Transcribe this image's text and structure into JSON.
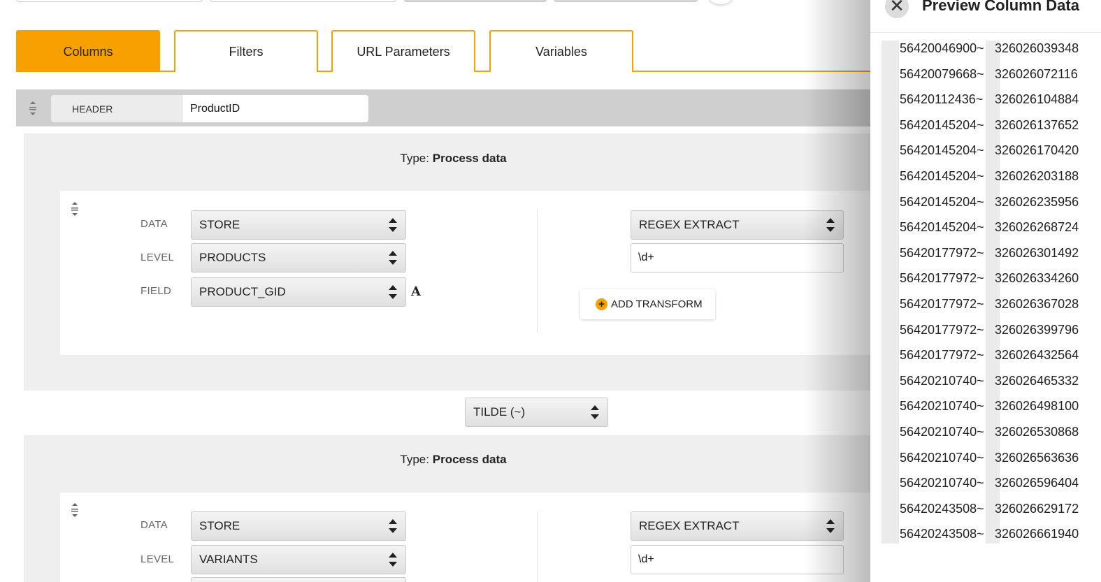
{
  "tabs": [
    {
      "label": "Columns",
      "active": true
    },
    {
      "label": "Filters",
      "active": false
    },
    {
      "label": "URL Parameters",
      "active": false
    },
    {
      "label": "Variables",
      "active": false
    }
  ],
  "header": {
    "label": "HEADER",
    "value": "ProductID"
  },
  "process_blocks": [
    {
      "type_prefix": "Type:",
      "type_value": "Process data",
      "fields": {
        "data_label": "DATA",
        "data_value": "STORE",
        "level_label": "LEVEL",
        "level_value": "PRODUCTS",
        "field_label": "FIELD",
        "field_value": "PRODUCT_GID",
        "field_type_icon": "A"
      },
      "transform": {
        "select_value": "REGEX EXTRACT",
        "pattern": "\\d+"
      },
      "add_transform_label": "ADD TRANSFORM"
    },
    {
      "type_prefix": "Type:",
      "type_value": "Process data",
      "fields": {
        "data_label": "DATA",
        "data_value": "STORE",
        "level_label": "LEVEL",
        "level_value": "VARIANTS"
      },
      "transform": {
        "select_value": "REGEX EXTRACT",
        "pattern": "\\d+"
      }
    }
  ],
  "separator": {
    "value": "TILDE (~)"
  },
  "preview": {
    "title": "Preview Column Data",
    "close_icon": "close-icon",
    "rows": [
      [
        "56420046900~",
        "326026039348"
      ],
      [
        "56420079668~",
        "326026072116"
      ],
      [
        "56420112436~",
        "326026104884"
      ],
      [
        "56420145204~",
        "326026137652"
      ],
      [
        "56420145204~",
        "326026170420"
      ],
      [
        "56420145204~",
        "326026203188"
      ],
      [
        "56420145204~",
        "326026235956"
      ],
      [
        "56420145204~",
        "326026268724"
      ],
      [
        "56420177972~",
        "326026301492"
      ],
      [
        "56420177972~",
        "326026334260"
      ],
      [
        "56420177972~",
        "326026367028"
      ],
      [
        "56420177972~",
        "326026399796"
      ],
      [
        "56420177972~",
        "326026432564"
      ],
      [
        "56420210740~",
        "326026465332"
      ],
      [
        "56420210740~",
        "326026498100"
      ],
      [
        "56420210740~",
        "326026530868"
      ],
      [
        "56420210740~",
        "326026563636"
      ],
      [
        "56420210740~",
        "326026596404"
      ],
      [
        "56420243508~",
        "326026629172"
      ],
      [
        "56420243508~",
        "326026661940"
      ]
    ]
  },
  "colors": {
    "accent": "#f7a000",
    "panel_grey": "#efefef",
    "header_grey": "#cfcfcf"
  }
}
